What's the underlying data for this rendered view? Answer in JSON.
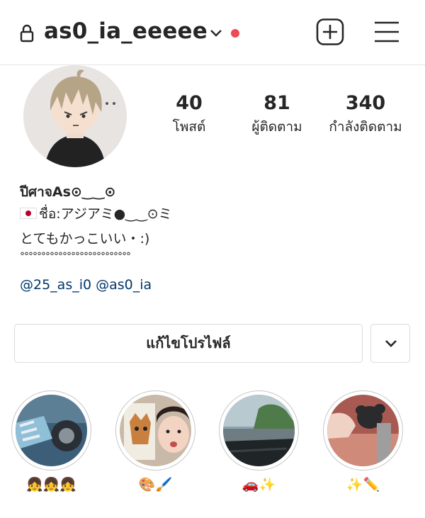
{
  "header": {
    "username": "as0_ia_eeeee",
    "icons": [
      "lock-icon",
      "chevron-down-icon",
      "notification-dot",
      "add-post-icon",
      "menu-icon"
    ],
    "accent_dot_color": "#ed4956"
  },
  "stats": [
    {
      "value": "40",
      "label": "โพสต์"
    },
    {
      "value": "81",
      "label": "ผู้ติดตาม"
    },
    {
      "value": "340",
      "label": "กำลังติดตาม"
    }
  ],
  "bio": {
    "name": "ปีศาจAs⊙‿‿⊙",
    "line1": "ชื่อ:アジアミ●‿‿⊙ミ",
    "line2": "とてもかっこいい・:)",
    "line3": "°°°°°°°°°°°°°°°°°°°°°°°°°°",
    "mentions": "@25_as_i0 @as0_ia",
    "link_color": "#00376b"
  },
  "actions": {
    "edit_profile": "แก้ไขโปรไฟล์"
  },
  "highlights": [
    {
      "caption": "👧👧👧"
    },
    {
      "caption": "🎨🖌️"
    },
    {
      "caption": "🚗✨"
    },
    {
      "caption": "✨✏️"
    }
  ]
}
